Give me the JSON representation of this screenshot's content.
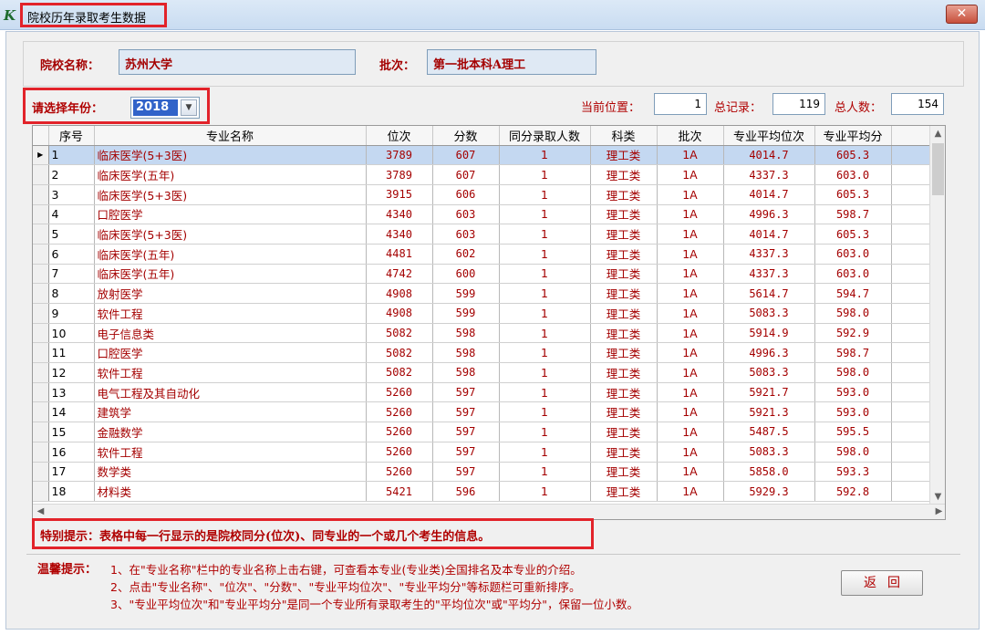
{
  "window": {
    "title": "院校历年录取考生数据",
    "icon": "app-logo-icon",
    "close_icon": "close-icon"
  },
  "school": {
    "label": "院校名称：",
    "value": "苏州大学"
  },
  "batch": {
    "label": "批次：",
    "value": "第一批本科A理工"
  },
  "year": {
    "label": "请选择年份：",
    "value": "2018"
  },
  "position": {
    "label": "当前位置：",
    "value": "1"
  },
  "total_records": {
    "label": "总记录：",
    "value": "119"
  },
  "total_people": {
    "label": "总人数：",
    "value": "154"
  },
  "table": {
    "columns": [
      "序号",
      "专业名称",
      "位次",
      "分数",
      "同分录取人数",
      "科类",
      "批次",
      "专业平均位次",
      "专业平均分"
    ],
    "rows": [
      [
        "1",
        "临床医学(5+3医)",
        "3789",
        "607",
        "1",
        "理工类",
        "1A",
        "4014.7",
        "605.3"
      ],
      [
        "2",
        "临床医学(五年)",
        "3789",
        "607",
        "1",
        "理工类",
        "1A",
        "4337.3",
        "603.0"
      ],
      [
        "3",
        "临床医学(5+3医)",
        "3915",
        "606",
        "1",
        "理工类",
        "1A",
        "4014.7",
        "605.3"
      ],
      [
        "4",
        "口腔医学",
        "4340",
        "603",
        "1",
        "理工类",
        "1A",
        "4996.3",
        "598.7"
      ],
      [
        "5",
        "临床医学(5+3医)",
        "4340",
        "603",
        "1",
        "理工类",
        "1A",
        "4014.7",
        "605.3"
      ],
      [
        "6",
        "临床医学(五年)",
        "4481",
        "602",
        "1",
        "理工类",
        "1A",
        "4337.3",
        "603.0"
      ],
      [
        "7",
        "临床医学(五年)",
        "4742",
        "600",
        "1",
        "理工类",
        "1A",
        "4337.3",
        "603.0"
      ],
      [
        "8",
        "放射医学",
        "4908",
        "599",
        "1",
        "理工类",
        "1A",
        "5614.7",
        "594.7"
      ],
      [
        "9",
        "软件工程",
        "4908",
        "599",
        "1",
        "理工类",
        "1A",
        "5083.3",
        "598.0"
      ],
      [
        "10",
        "电子信息类",
        "5082",
        "598",
        "1",
        "理工类",
        "1A",
        "5914.9",
        "592.9"
      ],
      [
        "11",
        "口腔医学",
        "5082",
        "598",
        "1",
        "理工类",
        "1A",
        "4996.3",
        "598.7"
      ],
      [
        "12",
        "软件工程",
        "5082",
        "598",
        "1",
        "理工类",
        "1A",
        "5083.3",
        "598.0"
      ],
      [
        "13",
        "电气工程及其自动化",
        "5260",
        "597",
        "1",
        "理工类",
        "1A",
        "5921.7",
        "593.0"
      ],
      [
        "14",
        "建筑学",
        "5260",
        "597",
        "1",
        "理工类",
        "1A",
        "5921.3",
        "593.0"
      ],
      [
        "15",
        "金融数学",
        "5260",
        "597",
        "1",
        "理工类",
        "1A",
        "5487.5",
        "595.5"
      ],
      [
        "16",
        "软件工程",
        "5260",
        "597",
        "1",
        "理工类",
        "1A",
        "5083.3",
        "598.0"
      ],
      [
        "17",
        "数学类",
        "5260",
        "597",
        "1",
        "理工类",
        "1A",
        "5858.0",
        "593.3"
      ],
      [
        "18",
        "材料类",
        "5421",
        "596",
        "1",
        "理工类",
        "1A",
        "5929.3",
        "592.8"
      ]
    ],
    "selected_row": 0
  },
  "notice": "特别提示：表格中每一行显示的是院校同分(位次)、同专业的一个或几个考生的信息。",
  "tips": {
    "label": "温馨提示：",
    "lines": [
      "1、在\"专业名称\"栏中的专业名称上击右键，可查看本专业(专业类)全国排名及本专业的介绍。",
      "2、点击\"专业名称\"、\"位次\"、\"分数\"、\"专业平均位次\"、\"专业平均分\"等标题栏可重新排序。",
      "3、\"专业平均位次\"和\"专业平均分\"是同一个专业所有录取考生的\"平均位次\"或\"平均分\"，保留一位小数。"
    ]
  },
  "back_button": "返回",
  "colors": {
    "highlight_border": "#e2232a",
    "text_red": "#a40000",
    "selected_row": "#c4d8f1"
  }
}
